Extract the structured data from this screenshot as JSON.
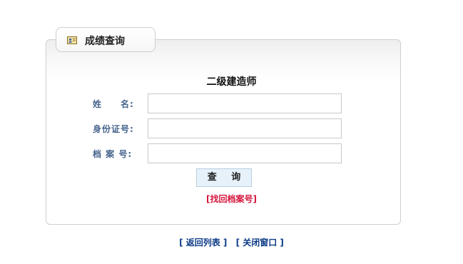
{
  "tab": {
    "title": "成绩查询",
    "icon": "id-card-icon"
  },
  "exam_title": "二级建造师",
  "form": {
    "name_label": "姓　　名:",
    "id_label": "身份证号:",
    "file_label": "档 案 号:",
    "name_value": "",
    "id_value": "",
    "file_value": ""
  },
  "query_button": "查 询",
  "retrieve_link": "[找回档案号]",
  "bottom": {
    "back_link": "[ 返回列表 ]",
    "close_link": "[ 关闭窗口 ]"
  }
}
